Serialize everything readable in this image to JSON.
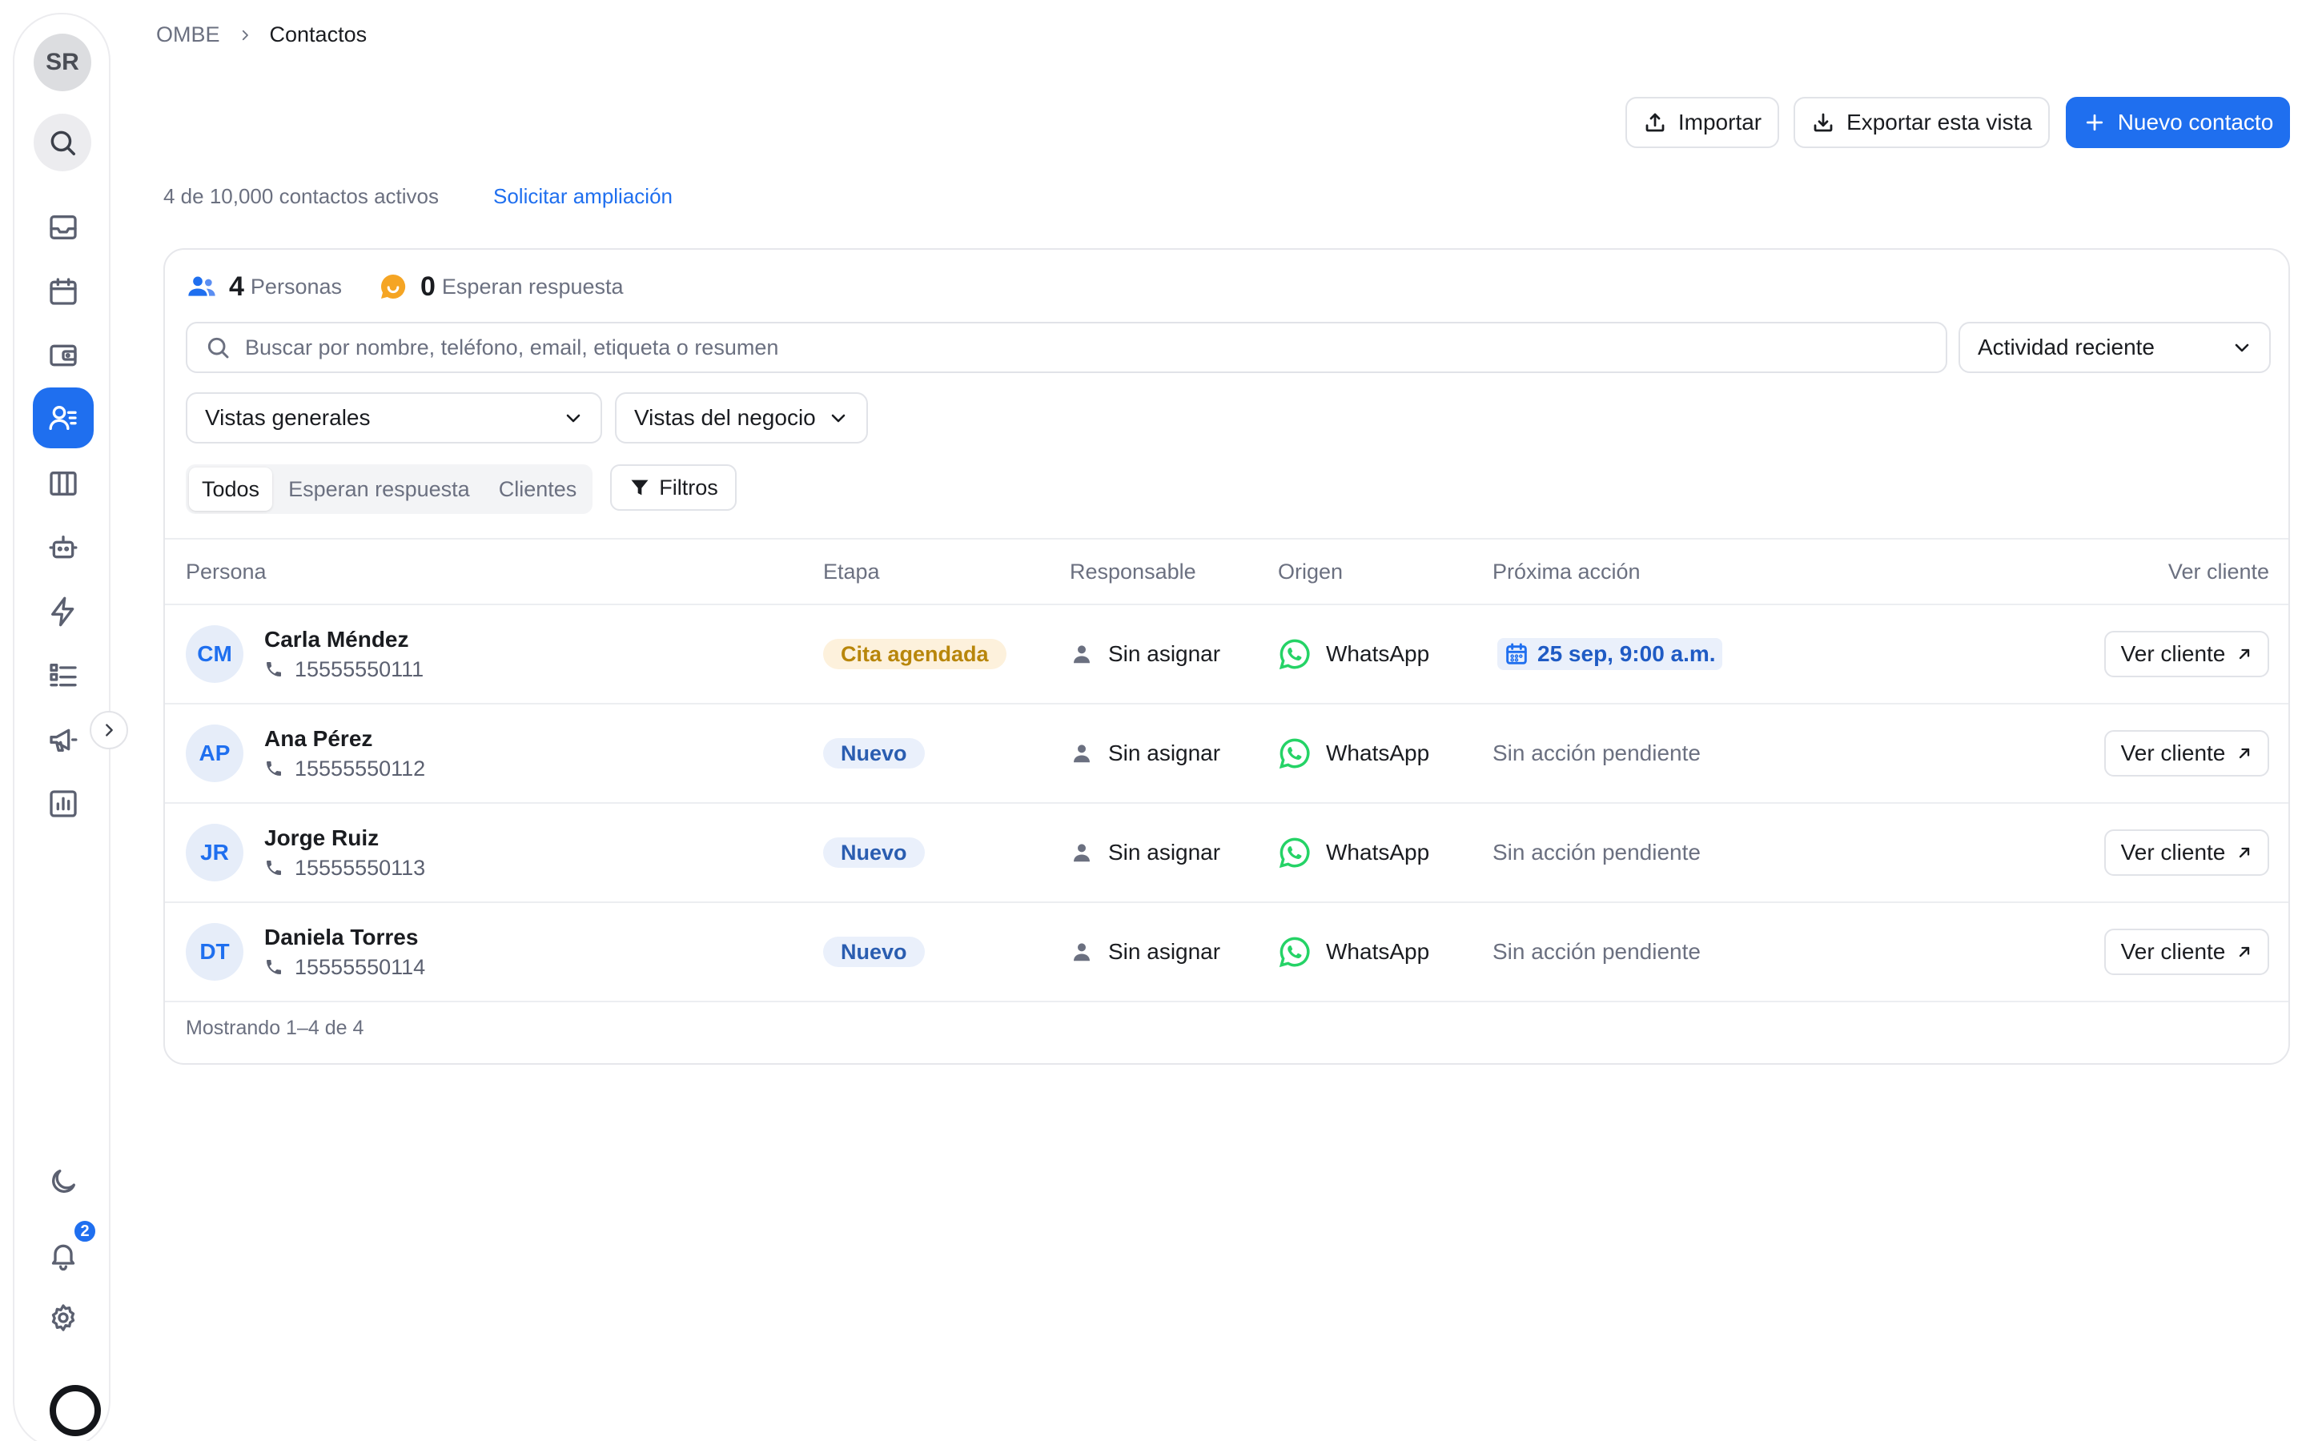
{
  "sidebar": {
    "avatar_initials": "SR",
    "items": [
      {
        "name": "inbox",
        "active": false
      },
      {
        "name": "calendar",
        "active": false
      },
      {
        "name": "wallet",
        "active": false
      },
      {
        "name": "contacts",
        "active": true
      },
      {
        "name": "board",
        "active": false
      },
      {
        "name": "bot",
        "active": false
      },
      {
        "name": "automations",
        "active": false
      },
      {
        "name": "lists",
        "active": false
      },
      {
        "name": "campaigns",
        "active": false
      },
      {
        "name": "reports",
        "active": false
      }
    ],
    "notifications_count": "2"
  },
  "breadcrumb": {
    "root": "OMBE",
    "current": "Contactos"
  },
  "actions": {
    "import_label": "Importar",
    "export_label": "Exportar esta vista",
    "new_label": "Nuevo contacto"
  },
  "quota": {
    "text": "4 de 10,000 contactos activos",
    "link": "Solicitar ampliación"
  },
  "stats": {
    "people_count": "4",
    "people_label": "Personas",
    "waiting_count": "0",
    "waiting_label": "Esperan respuesta"
  },
  "search": {
    "placeholder": "Buscar por nombre, teléfono, email, etiqueta o resumen"
  },
  "sort": {
    "value": "Actividad reciente"
  },
  "views": {
    "general": "Vistas generales",
    "business": "Vistas del negocio"
  },
  "segments": {
    "all": "Todos",
    "waiting": "Esperan respuesta",
    "clients": "Clientes"
  },
  "filters_label": "Filtros",
  "table": {
    "headers": {
      "person": "Persona",
      "stage": "Etapa",
      "owner": "Responsable",
      "origin": "Origen",
      "next": "Próxima acción",
      "view": "Ver cliente"
    },
    "rows": [
      {
        "initials": "CM",
        "name": "Carla Méndez",
        "phone": "15555550111",
        "stage": "Cita agendada",
        "owner": "Sin asignar",
        "origin": "WhatsApp",
        "next": "25 sep, 9:00 a.m.",
        "view": "Ver cliente"
      },
      {
        "initials": "AP",
        "name": "Ana Pérez",
        "phone": "15555550112",
        "stage": "Nuevo",
        "owner": "Sin asignar",
        "origin": "WhatsApp",
        "next": "Sin acción pendiente",
        "view": "Ver cliente"
      },
      {
        "initials": "JR",
        "name": "Jorge Ruiz",
        "phone": "15555550113",
        "stage": "Nuevo",
        "owner": "Sin asignar",
        "origin": "WhatsApp",
        "next": "Sin acción pendiente",
        "view": "Ver cliente"
      },
      {
        "initials": "DT",
        "name": "Daniela Torres",
        "phone": "15555550114",
        "stage": "Nuevo",
        "owner": "Sin asignar",
        "origin": "WhatsApp",
        "next": "Sin acción pendiente",
        "view": "Ver cliente"
      }
    ]
  },
  "footer": {
    "showing": "Mostrando 1–4 de 4"
  },
  "colors": {
    "accent": "#1f6fef",
    "whatsapp": "#25d366",
    "warning_badge": "#fdf1dc"
  }
}
